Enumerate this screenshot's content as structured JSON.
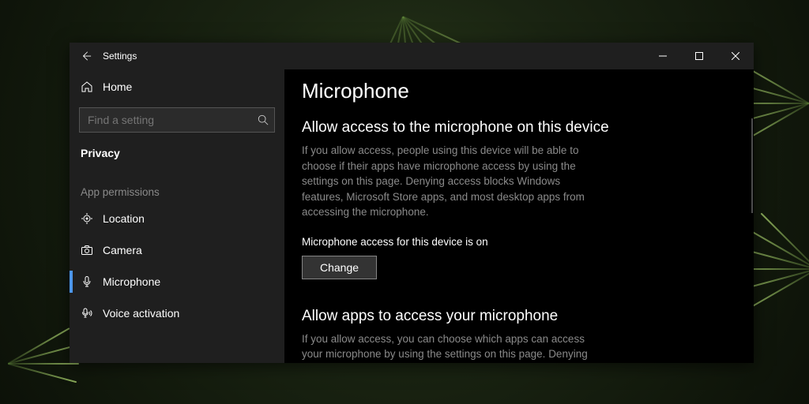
{
  "window": {
    "title": "Settings"
  },
  "sidebar": {
    "home_label": "Home",
    "search_placeholder": "Find a setting",
    "category_label": "Privacy",
    "group_header": "App permissions",
    "items": [
      {
        "label": "Location"
      },
      {
        "label": "Camera"
      },
      {
        "label": "Microphone"
      },
      {
        "label": "Voice activation"
      }
    ]
  },
  "main": {
    "page_title": "Microphone",
    "sections": [
      {
        "title": "Allow access to the microphone on this device",
        "desc": "If you allow access, people using this device will be able to choose if their apps have microphone access by using the settings on this page. Denying access blocks Windows features, Microsoft Store apps, and most desktop apps from accessing the microphone.",
        "status": "Microphone access for this device is on",
        "button": "Change"
      },
      {
        "title": "Allow apps to access your microphone",
        "desc": "If you allow access, you can choose which apps can access your microphone by using the settings on this page. Denying access blocks apps from accessing your microphone."
      }
    ]
  }
}
